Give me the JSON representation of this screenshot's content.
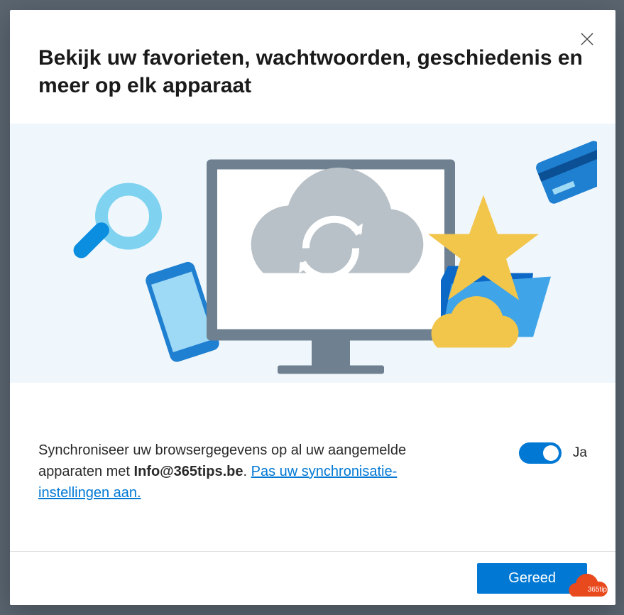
{
  "dialog": {
    "title": "Bekijk uw favorieten, wachtwoorden, geschiedenis en meer op elk apparaat",
    "close_icon": "close"
  },
  "sync": {
    "text_prefix": "Synchroniseer uw browsergegevens op al uw aangemelde apparaten met ",
    "account_email": "Info@365tips.be",
    "text_separator": ". ",
    "link_text": "Pas uw synchronisatie-instellingen aan.",
    "toggle_state": "on",
    "toggle_label": "Ja"
  },
  "footer": {
    "done_button_label": "Gereed"
  },
  "watermark": {
    "label": "365tips"
  },
  "colors": {
    "accent": "#0078d4",
    "illustration_bg": "#f0f7fc"
  }
}
